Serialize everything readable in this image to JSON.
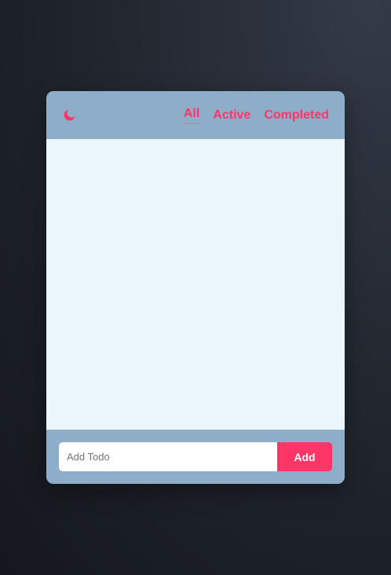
{
  "colors": {
    "accent": "#fe3567",
    "header_bg": "#8dadc9",
    "list_bg": "#ebf6fc"
  },
  "header": {
    "theme_toggle_icon": "moon-icon",
    "tabs": [
      {
        "label": "All",
        "active": true
      },
      {
        "label": "Active",
        "active": false
      },
      {
        "label": "Completed",
        "active": false
      }
    ]
  },
  "todos": [],
  "footer": {
    "input_placeholder": "Add Todo",
    "input_value": "",
    "add_label": "Add"
  }
}
